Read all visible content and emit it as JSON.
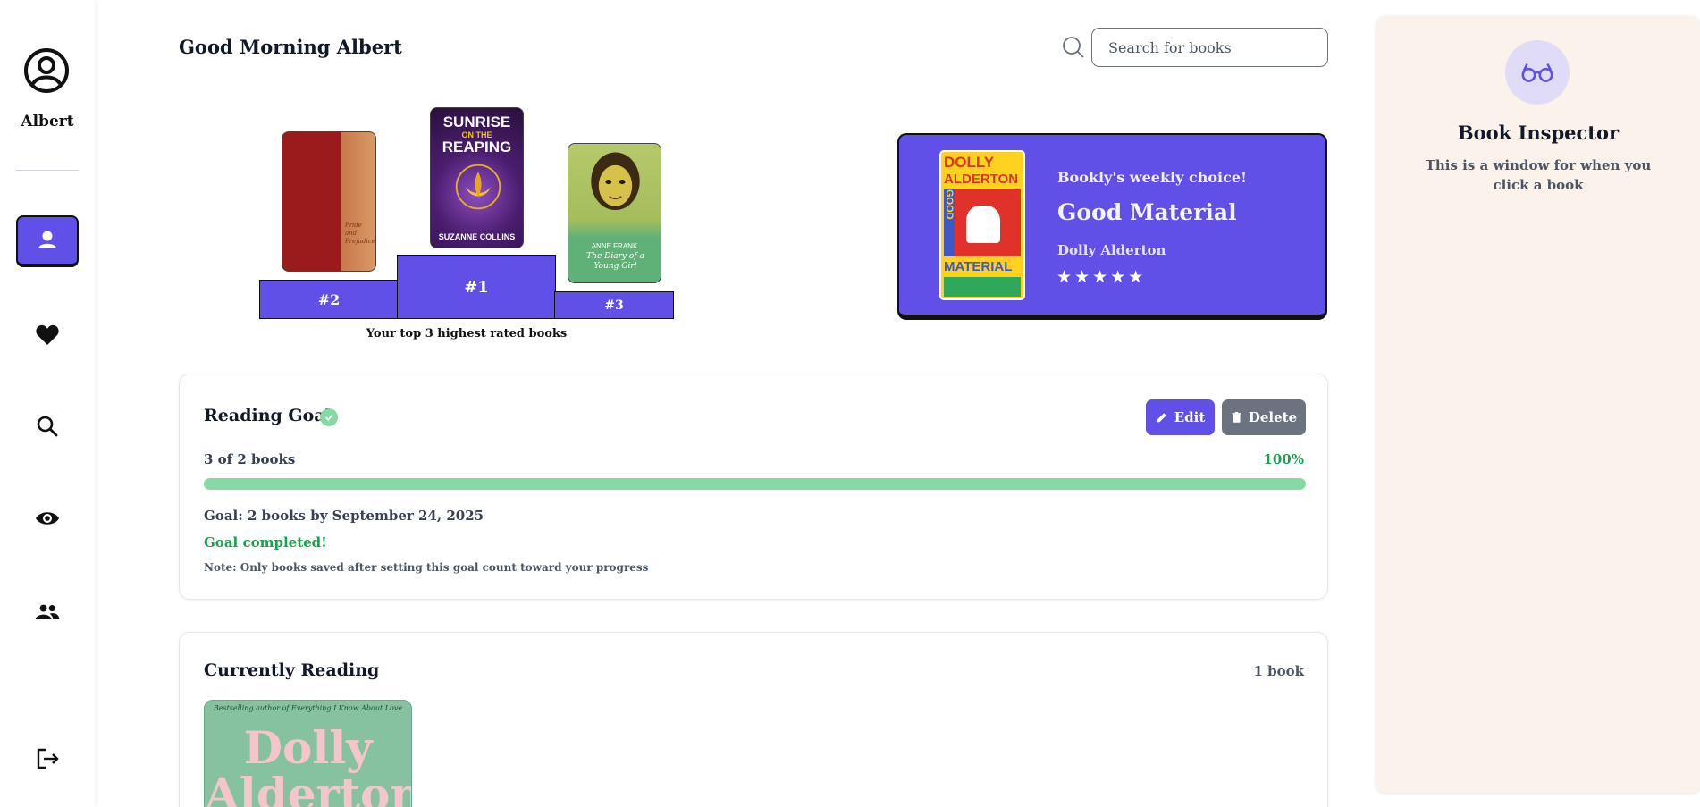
{
  "user": {
    "name": "Albert"
  },
  "nav": {
    "items": [
      {
        "name": "profile",
        "icon": "person-icon",
        "active": true
      },
      {
        "name": "favorites",
        "icon": "heart-icon",
        "active": false
      },
      {
        "name": "search",
        "icon": "search-icon",
        "active": false
      },
      {
        "name": "watch",
        "icon": "eye-icon",
        "active": false
      },
      {
        "name": "friends",
        "icon": "group-icon",
        "active": false
      }
    ],
    "logout_icon": "logout-icon"
  },
  "header": {
    "greeting": "Good Morning Albert",
    "search_placeholder": "Search for books"
  },
  "podium": {
    "caption": "Your top 3 highest rated books",
    "ranks": [
      {
        "rank": "#2",
        "cover": {
          "title": "Pride and Prejudice"
        }
      },
      {
        "rank": "#1",
        "cover": {
          "title_line1": "SUNRISE",
          "title_line2": "ON THE",
          "title_line3": "REAPING",
          "author": "SUZANNE COLLINS"
        }
      },
      {
        "rank": "#3",
        "cover": {
          "author": "ANNE FRANK",
          "title": "The Diary of a Young Girl"
        }
      }
    ]
  },
  "weekly_choice": {
    "kicker": "Bookly's weekly choice!",
    "title": "Good Material",
    "author": "Dolly Alderton",
    "stars": "★★★★★",
    "cover": {
      "line1": "DOLLY",
      "line2": "ALDERTON",
      "line3": "GOOD",
      "line4": "MATERIAL"
    },
    "accent": "#6150e8"
  },
  "reading_goal": {
    "title": "Reading Goal",
    "edit_label": "Edit",
    "delete_label": "Delete",
    "count_text": "3 of 2 books",
    "percent_text": "100%",
    "progress": 1.0,
    "deadline_text": "Goal: 2 books by September 24, 2025",
    "status_text": "Goal completed!",
    "note_text": "Note: Only books saved after setting this goal count toward your progress",
    "progress_color": "#86d9a4"
  },
  "currently_reading": {
    "title": "Currently Reading",
    "count_text": "1 book",
    "book": {
      "tagline": "Bestselling author of Everything I Know About Love",
      "name_line1": "Dolly",
      "name_line2": "Alderton"
    }
  },
  "inspector": {
    "title": "Book Inspector",
    "text": "This is a window for when you click a book",
    "icon": "glasses-icon"
  }
}
